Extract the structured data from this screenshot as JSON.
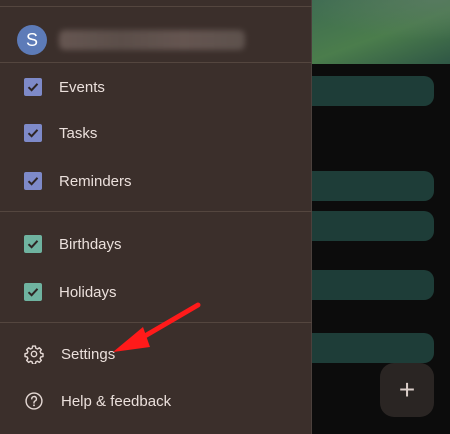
{
  "account": {
    "avatar_initial": "S"
  },
  "calendars": [
    {
      "label": "Events",
      "checked": true,
      "color": "#7e8ac9"
    },
    {
      "label": "Tasks",
      "checked": true,
      "color": "#7e8ac9"
    },
    {
      "label": "Reminders",
      "checked": true,
      "color": "#7e8ac9"
    }
  ],
  "other_calendars": [
    {
      "label": "Birthdays",
      "checked": true,
      "color": "#6fb3a0"
    },
    {
      "label": "Holidays",
      "checked": true,
      "color": "#6fb3a0"
    }
  ],
  "menu": {
    "settings_label": "Settings",
    "help_label": "Help & feedback"
  },
  "fab": {
    "glyph": "+"
  },
  "colors": {
    "drawer_bg": "#3b2f2b",
    "primary_checkbox": "#7e8ac9",
    "secondary_checkbox": "#6fb3a0",
    "arrow": "#ff1a1a"
  }
}
